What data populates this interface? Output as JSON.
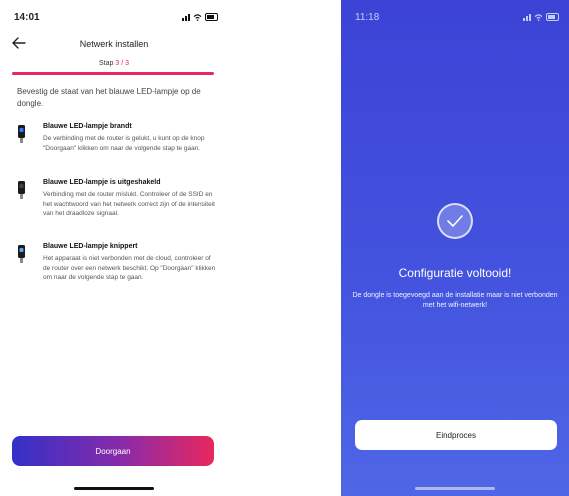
{
  "left": {
    "status": {
      "time": "14:01"
    },
    "header": {
      "title": "Netwerk installen"
    },
    "step": {
      "prefix": "Stap ",
      "current": "3 / 3"
    },
    "intro": "Bevestig de staat van het blauwe LED-lampje op de dongle.",
    "items": [
      {
        "title": "Blauwe LED-lampje brandt",
        "desc": "De verbinding met de router is gelukt, u kunt op de knop \"Doorgaan\" klikken om naar de volgende stap te gaan.",
        "icon": "dongle-led-on-icon"
      },
      {
        "title": "Blauwe LED-lampje is uitgeshakeld",
        "desc": "Verbinding met de router mislukt. Controleer of de SSID en het wachtwoord van het netwerk correct zijn of de intensiteit van het draadloze signaal.",
        "icon": "dongle-led-off-icon"
      },
      {
        "title": "Blauwe LED-lampje knippert",
        "desc": "Het apparaat is niet verbonden met de cloud, controleer of de router over een netwerk beschikt. Op \"Doorgaan\" klikken om naar de volgende stap te gaan.",
        "icon": "dongle-led-blink-icon"
      }
    ],
    "next_button": "Doorgaan",
    "colors": {
      "accent": "#e8285e",
      "gradient_start": "#3430c8",
      "gradient_end": "#e8285e"
    }
  },
  "right": {
    "status": {
      "time": "11:18"
    },
    "title": "Configuratie voltooid!",
    "desc": "De dongle is toegevoegd aan de installatie maar is niet verbonden met het wifi-netwerk!",
    "finish_button": "Eindproces",
    "colors": {
      "background": "#4353de"
    }
  }
}
